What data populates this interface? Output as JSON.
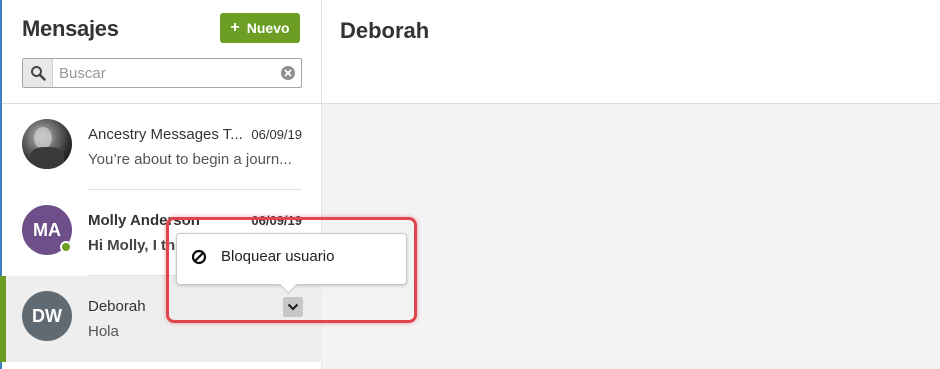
{
  "sidebar": {
    "title": "Mensajes",
    "new_button": {
      "plus": "+",
      "label": "Nuevo"
    },
    "search": {
      "placeholder": "Buscar",
      "value": ""
    },
    "conversations": [
      {
        "name": "Ancestry Messages T...",
        "date": "06/09/19",
        "preview": "You’re about to begin a journ...",
        "avatar": "photo",
        "unread": false
      },
      {
        "name": "Molly Anderson",
        "date": "06/09/19",
        "preview": "Hi Molly, I thi...",
        "avatar_initials": "MA",
        "online": true,
        "unread": true
      },
      {
        "name": "Deborah",
        "preview": "Hola",
        "avatar_initials": "DW",
        "selected": true
      }
    ]
  },
  "main": {
    "title": "Deborah"
  },
  "context_menu": {
    "items": [
      {
        "label": "Bloquear usuario",
        "icon": "block-icon"
      }
    ]
  },
  "colors": {
    "accent_green": "#6b9e23",
    "highlight_red": "#e0444c",
    "avatar_ma": "#6e4f8a",
    "avatar_dw": "#5f6a73"
  }
}
